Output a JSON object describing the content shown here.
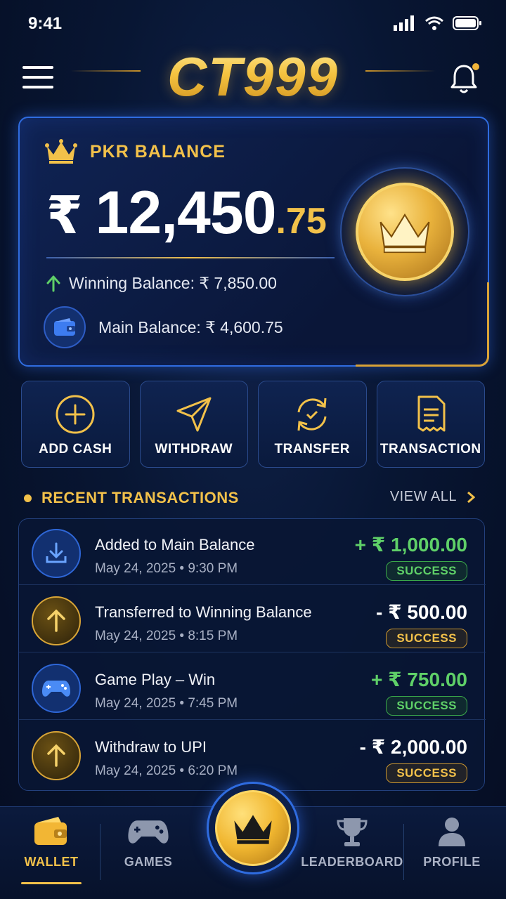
{
  "status_bar": {
    "time": "9:41"
  },
  "header": {
    "logo": "CT999"
  },
  "balance": {
    "label": "PKR BALANCE",
    "currency": "₹",
    "whole": "12,450",
    "fraction": ".75",
    "winning": "Winning Balance: ₹ 7,850.00",
    "main": "Main Balance: ₹ 4,600.75"
  },
  "actions": [
    {
      "label": "ADD CASH",
      "icon": "plus-circle-icon"
    },
    {
      "label": "WITHDRAW",
      "icon": "send-icon"
    },
    {
      "label": "TRANSFER",
      "icon": "transfer-icon"
    },
    {
      "label": "TRANSACTION",
      "icon": "receipt-icon"
    }
  ],
  "recent": {
    "title": "RECENT TRANSACTIONS",
    "view_all": "VIEW ALL",
    "items": [
      {
        "title": "Added to Main Balance",
        "date": "May 24, 2025 • 9:30 PM",
        "amount": "+ ₹ 1,000.00",
        "status": "SUCCESS",
        "icon": "download-icon"
      },
      {
        "title": "Transferred to Winning Balance",
        "date": "May 24, 2025 • 8:15 PM",
        "amount": "- ₹ 500.00",
        "status": "SUCCESS",
        "icon": "arrow-up-icon"
      },
      {
        "title": "Game Play – Win",
        "date": "May 24, 2025 • 7:45 PM",
        "amount": "+ ₹ 750.00",
        "status": "SUCCESS",
        "icon": "gamepad-icon"
      },
      {
        "title": "Withdraw to UPI",
        "date": "May 24, 2025 • 6:20 PM",
        "amount": "- ₹ 2,000.00",
        "status": "SUCCESS",
        "icon": "arrow-up-icon"
      }
    ]
  },
  "nav": [
    {
      "label": "WALLET",
      "icon": "wallet-icon",
      "active": true
    },
    {
      "label": "GAMES",
      "icon": "gamepad-icon"
    },
    {
      "label": "",
      "icon": "crown-icon"
    },
    {
      "label": "LEADERBOARD",
      "icon": "trophy-icon"
    },
    {
      "label": "PROFILE",
      "icon": "user-icon"
    }
  ],
  "colors": {
    "accent_gold": "#f2c14a",
    "accent_blue": "#2f6ce0",
    "positive": "#5fd068"
  }
}
